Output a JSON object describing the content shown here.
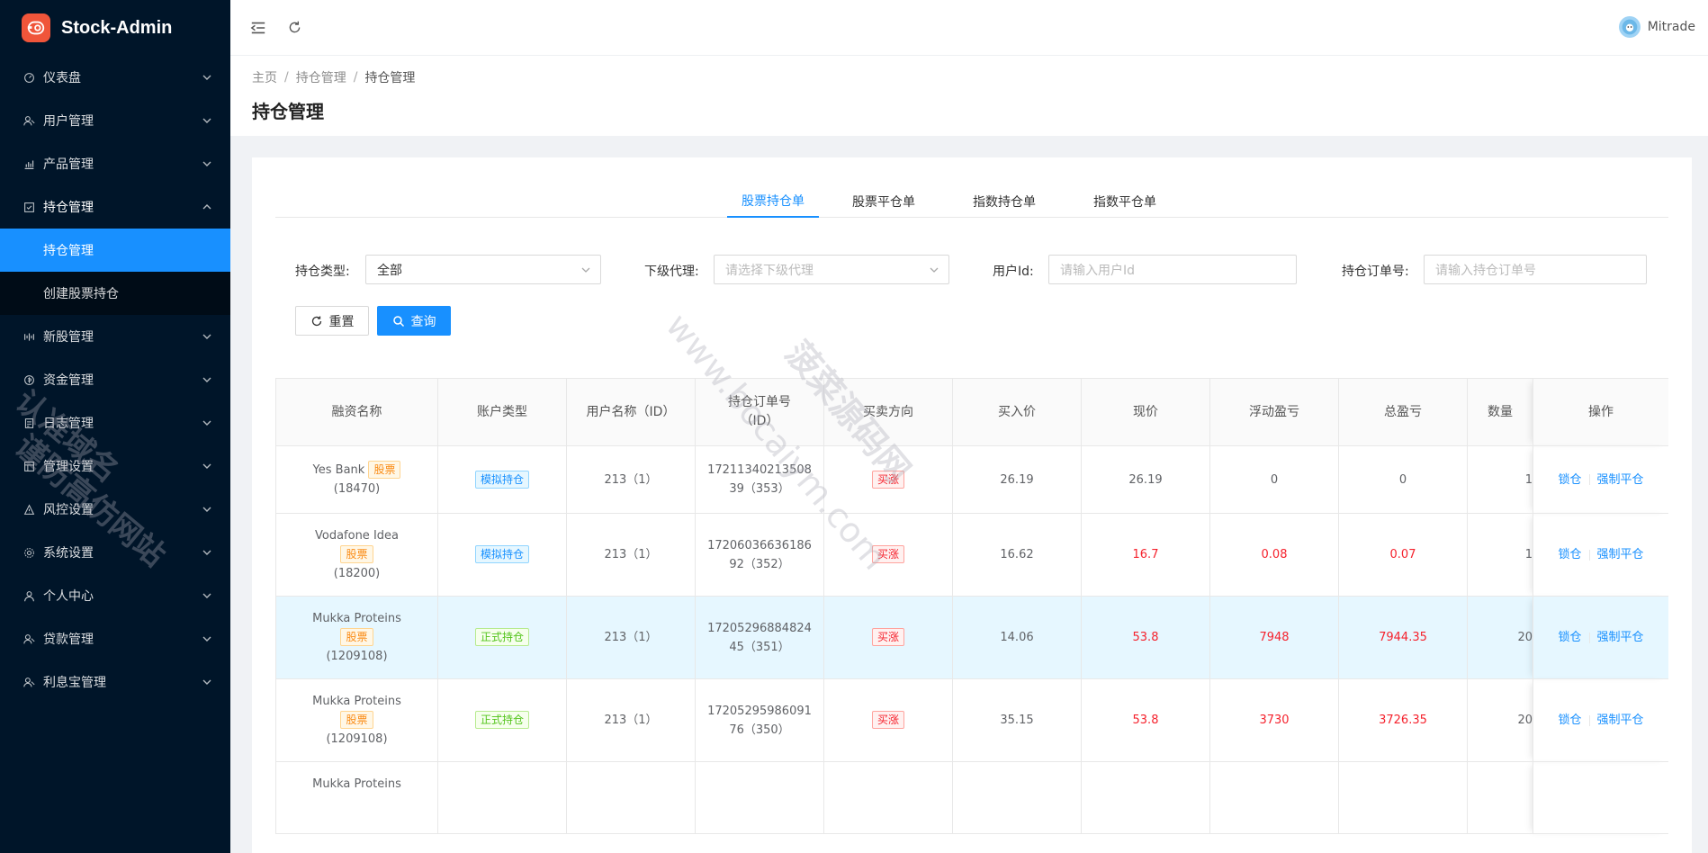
{
  "app": {
    "name": "Stock-Admin"
  },
  "sidebar": {
    "items": [
      {
        "label": "仪表盘",
        "icon": "dashboard-icon"
      },
      {
        "label": "用户管理",
        "icon": "users-icon"
      },
      {
        "label": "产品管理",
        "icon": "chart-icon"
      },
      {
        "label": "持仓管理",
        "icon": "position-icon",
        "open": true
      },
      {
        "label": "新股管理",
        "icon": "new-stock-icon"
      },
      {
        "label": "资金管理",
        "icon": "funds-icon"
      },
      {
        "label": "日志管理",
        "icon": "log-icon"
      },
      {
        "label": "管理设置",
        "icon": "admin-settings-icon"
      },
      {
        "label": "风控设置",
        "icon": "risk-icon"
      },
      {
        "label": "系统设置",
        "icon": "gear-icon"
      },
      {
        "label": "个人中心",
        "icon": "user-icon"
      },
      {
        "label": "贷款管理",
        "icon": "loan-icon"
      },
      {
        "label": "利息宝管理",
        "icon": "interest-icon"
      }
    ],
    "submenu": [
      {
        "label": "持仓管理",
        "active": true
      },
      {
        "label": "创建股票持仓",
        "active": false
      }
    ]
  },
  "header": {
    "user_name": "Mitrade"
  },
  "breadcrumb": [
    "主页",
    "持仓管理",
    "持仓管理"
  ],
  "page_title": "持仓管理",
  "tabs": [
    "股票持仓单",
    "股票平仓单",
    "指数持仓单",
    "指数平仓单"
  ],
  "filters": {
    "type_label": "持仓类型:",
    "type_value": "全部",
    "agent_label": "下级代理:",
    "agent_placeholder": "请选择下级代理",
    "user_label": "用户Id:",
    "user_placeholder": "请输入用户Id",
    "order_label": "持仓订单号:",
    "order_placeholder": "请输入持仓订单号"
  },
  "buttons": {
    "reset": "重置",
    "search": "查询"
  },
  "table": {
    "columns": [
      "融资名称",
      "账户类型",
      "用户名称（ID）",
      "持仓订单号\n（ID）",
      "买卖方向",
      "买入价",
      "现价",
      "浮动盈亏",
      "总盈亏",
      "数量",
      "操作"
    ],
    "rows": [
      {
        "name": "Yes Bank",
        "tag": "股票",
        "code": "(18470)",
        "account": "模拟持仓",
        "account_type": "demo",
        "user": "213（1）",
        "order": "17211340213508\n39（353）",
        "direction": "买涨",
        "buy": "26.19",
        "now": "26.19",
        "float": "0",
        "total": "0",
        "qty": "1",
        "highlight_red": false,
        "hl": false
      },
      {
        "name": "Vodafone Idea",
        "tag": "股票",
        "code": "(18200)",
        "account": "模拟持仓",
        "account_type": "demo",
        "user": "213（1）",
        "order": "17206036636186\n92（352）",
        "direction": "买涨",
        "buy": "16.62",
        "now": "16.7",
        "float": "0.08",
        "total": "0.07",
        "qty": "1",
        "highlight_red": true,
        "hl": false
      },
      {
        "name": "Mukka Proteins",
        "tag": "股票",
        "code": "(1209108)",
        "account": "正式持仓",
        "account_type": "live",
        "user": "213（1）",
        "order": "17205296884824\n45（351）",
        "direction": "买涨",
        "buy": "14.06",
        "now": "53.8",
        "float": "7948",
        "total": "7944.35",
        "qty": "20",
        "highlight_red": true,
        "hl": true
      },
      {
        "name": "Mukka Proteins",
        "tag": "股票",
        "code": "(1209108)",
        "account": "正式持仓",
        "account_type": "live",
        "user": "213（1）",
        "order": "17205295986091\n76（350）",
        "direction": "买涨",
        "buy": "35.15",
        "now": "53.8",
        "float": "3730",
        "total": "3726.35",
        "qty": "20",
        "highlight_red": true,
        "hl": false
      },
      {
        "name": "Mukka Proteins",
        "tag": "",
        "code": "",
        "account": "",
        "account_type": "",
        "user": "",
        "order": "",
        "direction": "",
        "buy": "",
        "now": "",
        "float": "",
        "total": "",
        "qty": "",
        "highlight_red": false,
        "hl": false
      }
    ],
    "actions": {
      "lock": "锁仓",
      "close": "强制平仓"
    }
  },
  "watermark": {
    "line1": "认准域名",
    "line2": "谨防高仿网站",
    "line3": "www.bocaiym.com",
    "line4": "菠菜源码网"
  }
}
